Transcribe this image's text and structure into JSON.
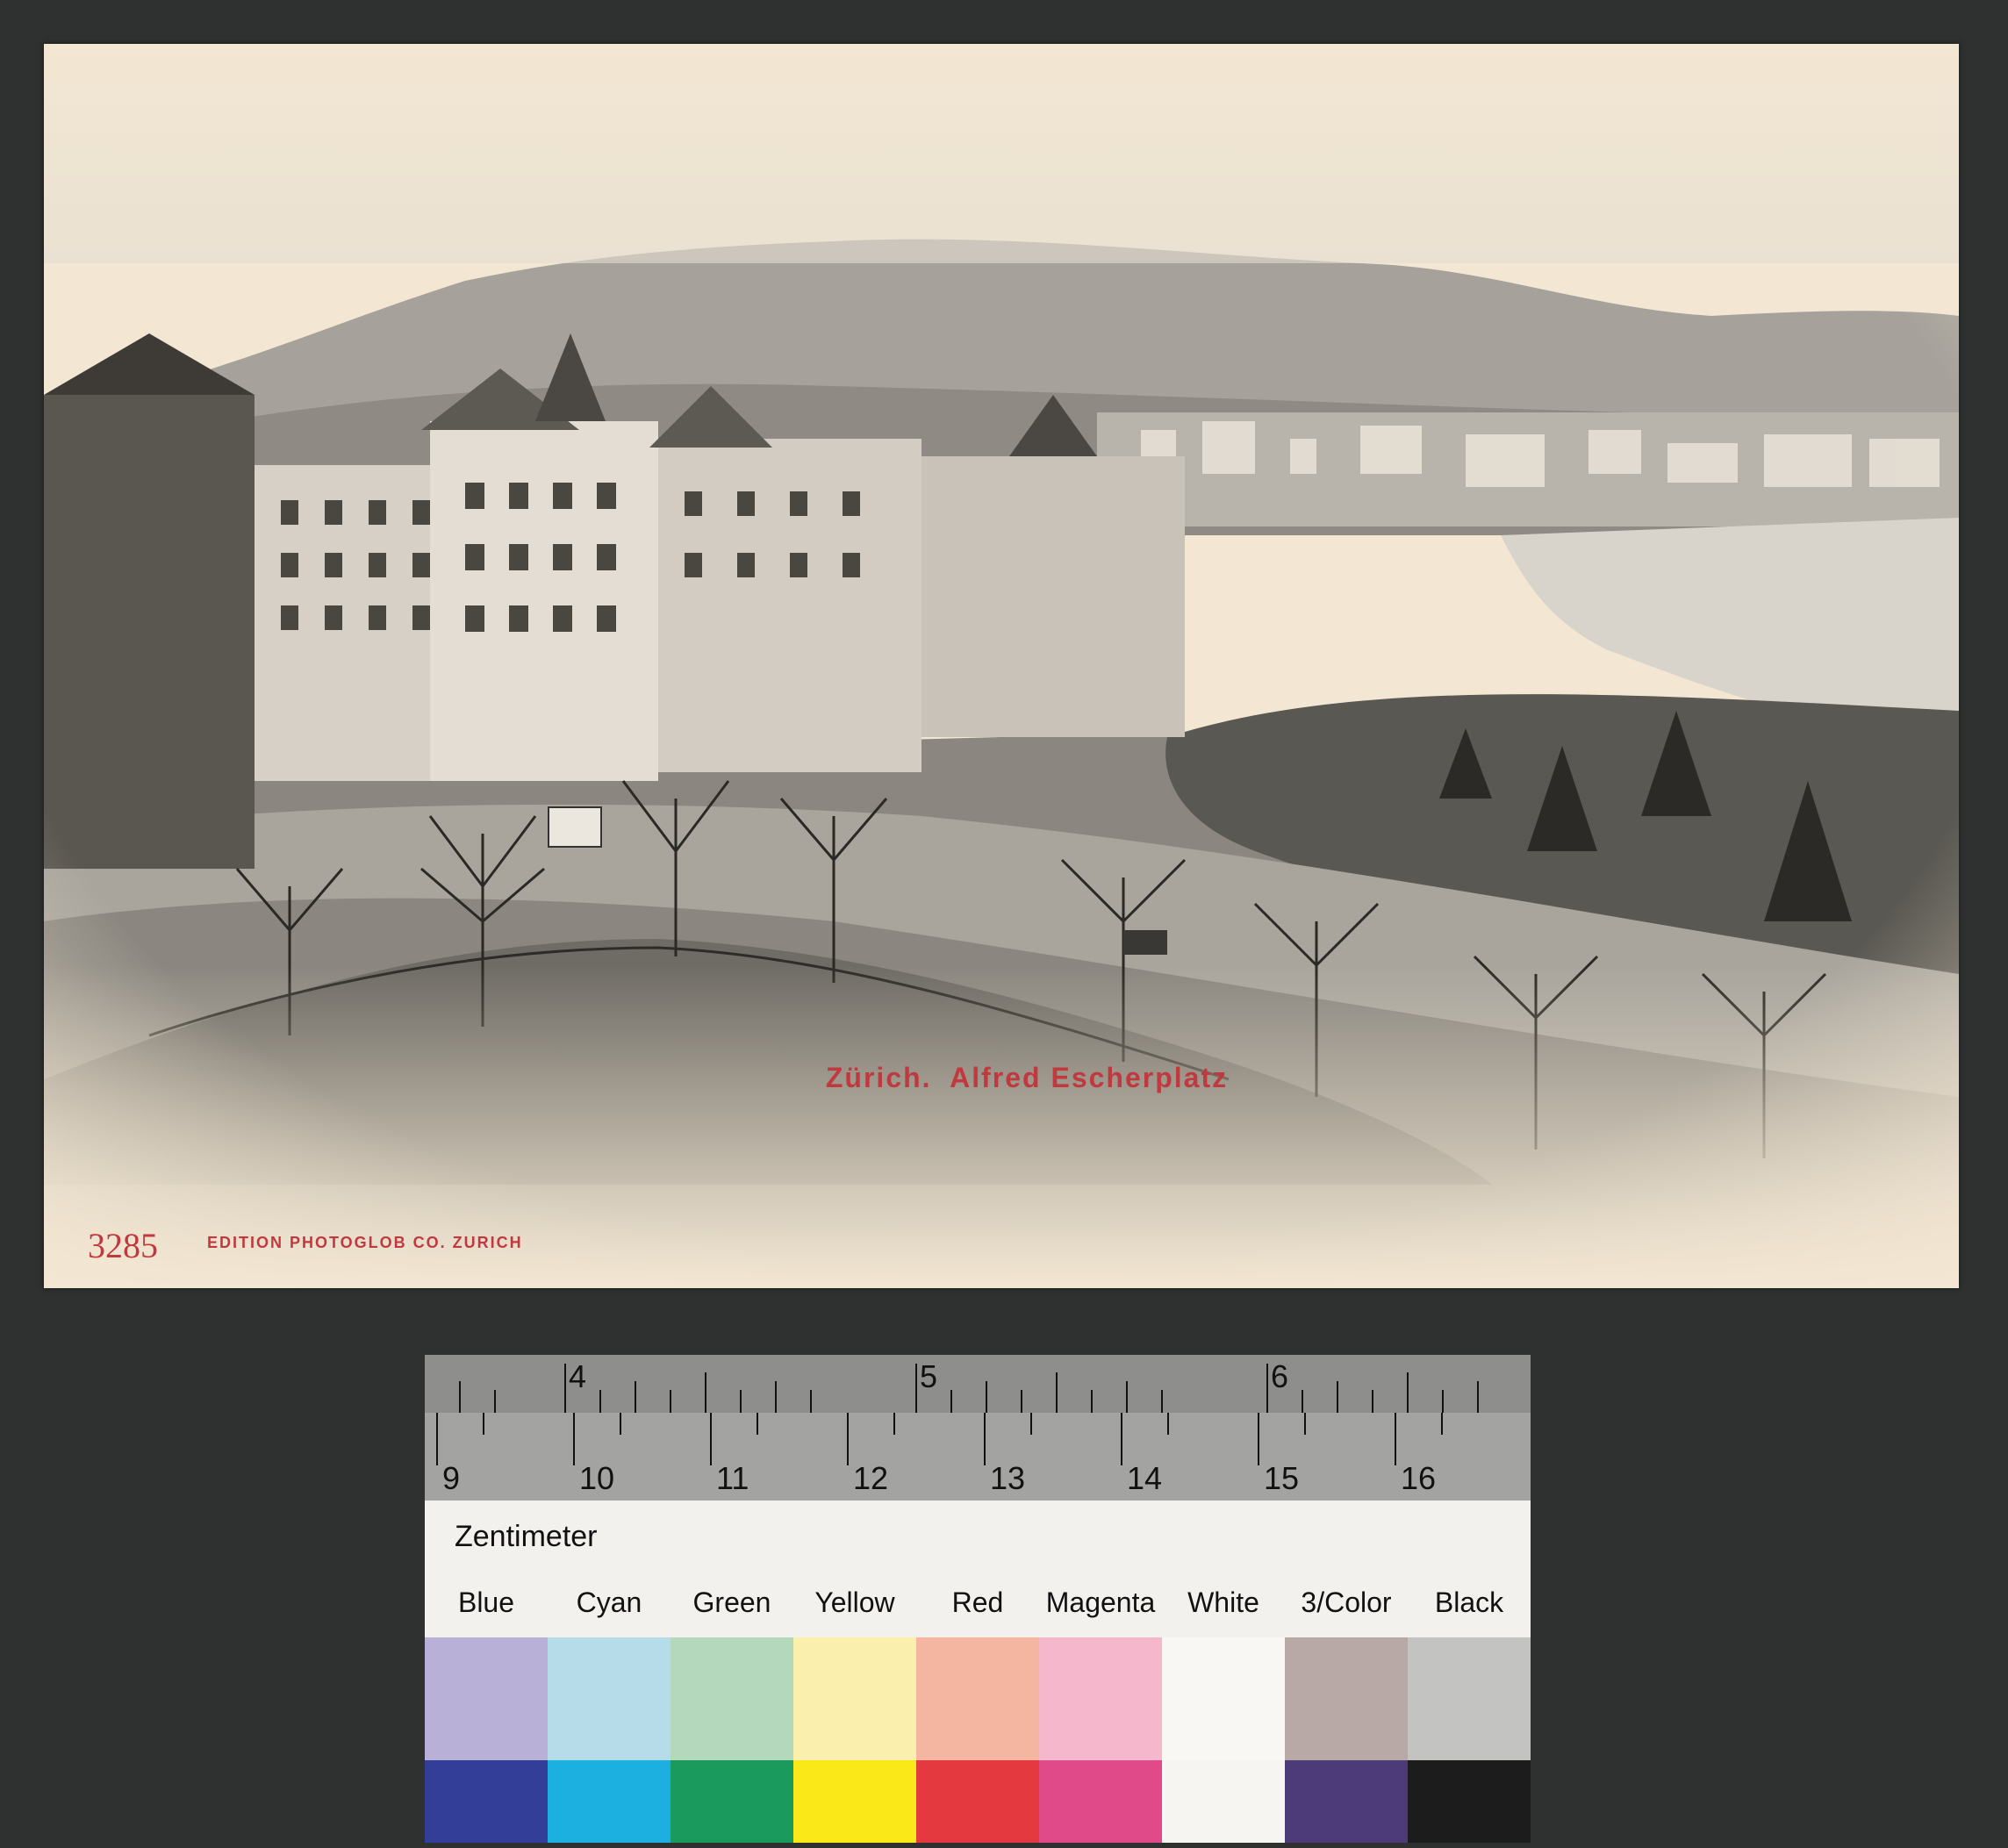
{
  "postcard": {
    "caption": "Zürich.  Alfred Escherplatz",
    "number": "3285",
    "publisher": "EDITION PHOTOGLOB CO. ZURICH",
    "accent_color": "#c0393f"
  },
  "color_target": {
    "ruler_top_labels": [
      "4",
      "5",
      "6"
    ],
    "ruler_bottom_labels": [
      "9",
      "10",
      "11",
      "12",
      "13",
      "14",
      "15",
      "16"
    ],
    "units_label": "Zentimeter",
    "patches": [
      {
        "name": "Blue",
        "light": "#b9b0d8",
        "dark": "#323e98"
      },
      {
        "name": "Cyan",
        "light": "#b6dcea",
        "dark": "#1cb0e0"
      },
      {
        "name": "Green",
        "light": "#b4d8bb",
        "dark": "#1a9a5c"
      },
      {
        "name": "Yellow",
        "light": "#fbefae",
        "dark": "#fbe818"
      },
      {
        "name": "Red",
        "light": "#f4b6a0",
        "dark": "#e3393f"
      },
      {
        "name": "Magenta",
        "light": "#f5b7cb",
        "dark": "#e04a89"
      },
      {
        "name": "White",
        "light": "#f8f7f3",
        "dark": "#f6f5f1"
      },
      {
        "name": "3/Color",
        "light": "#b9a9a6",
        "dark": "#4d3a78"
      },
      {
        "name": "Black",
        "light": "#c3c3c2",
        "dark": "#1c1c1c"
      }
    ]
  }
}
